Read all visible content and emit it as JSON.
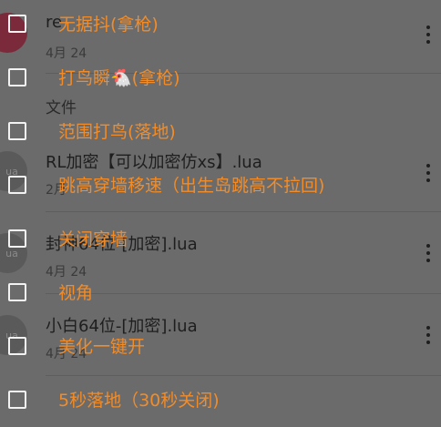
{
  "files": [
    {
      "icon": "",
      "name": "re",
      "date": "4月 24",
      "icon_color": "red"
    },
    {
      "icon": "ua",
      "name": "RL加密【可以加密仿xs】.lua",
      "date": "2月"
    },
    {
      "icon": "ua",
      "name": "封神64位-[加密].lua",
      "date": "4月 24"
    },
    {
      "icon": "ua",
      "name": "小白64位-[加密].lua",
      "date": "4月 24"
    }
  ],
  "section_header": "文件",
  "options": [
    {
      "label": "无据抖(拿枪)"
    },
    {
      "label": "打鸟瞬🐔(拿枪)"
    },
    {
      "label": "范围打鸟(落地)"
    },
    {
      "label": "跳高穿墙移速（出生岛跳高不拉回)"
    },
    {
      "label": "关闭穿墙"
    },
    {
      "label": "视角"
    },
    {
      "label": "美化一键开"
    },
    {
      "label": "5秒落地（30秒关闭)"
    }
  ]
}
